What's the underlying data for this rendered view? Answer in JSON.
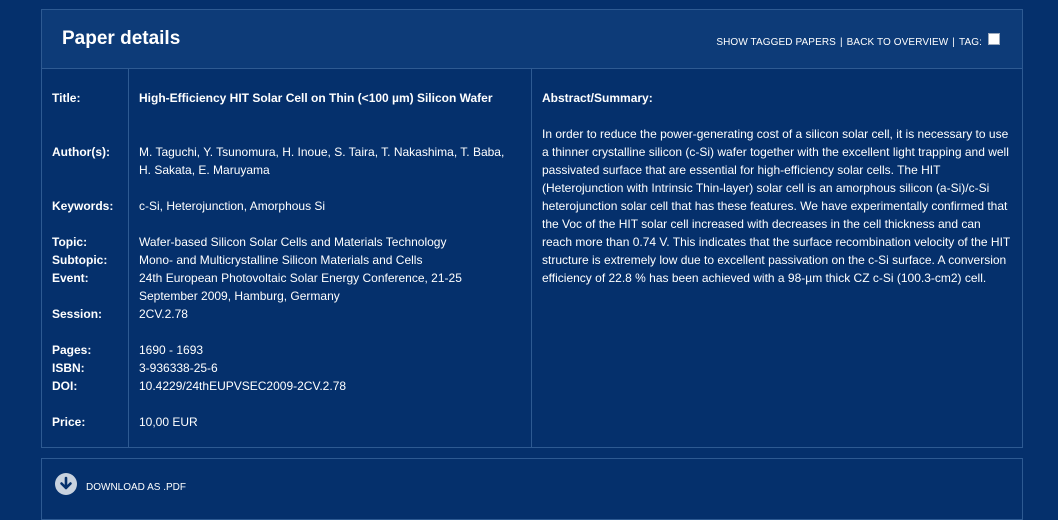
{
  "header": {
    "title": "Paper details",
    "show_tagged": "SHOW TAGGED PAPERS",
    "separator": "|",
    "back_to_overview": "BACK TO OVERVIEW",
    "tag_label": "TAG:"
  },
  "details": {
    "title_label": "Title:",
    "title_value": "High-Efficiency HIT Solar Cell on Thin (<100 µm) Silicon Wafer",
    "authors_label": "Author(s):",
    "authors_value": "M. Taguchi, Y. Tsunomura, H. Inoue, S. Taira, T. Nakashima, T. Baba, H. Sakata, E. Maruyama",
    "keywords_label": "Keywords:",
    "keywords_value": "c-Si, Heterojunction, Amorphous Si",
    "topic_label": "Topic:",
    "topic_value": "Wafer-based Silicon Solar Cells and Materials Technology",
    "subtopic_label": "Subtopic:",
    "subtopic_value": "Mono- and Multicrystalline Silicon Materials and Cells",
    "event_label": "Event:",
    "event_value": "24th European Photovoltaic Solar Energy Conference, 21-25 September 2009, Hamburg, Germany",
    "session_label": "Session:",
    "session_value": "2CV.2.78",
    "pages_label": "Pages:",
    "pages_value": "1690 - 1693",
    "isbn_label": "ISBN:",
    "isbn_value": "3-936338-25-6",
    "doi_label": "DOI:",
    "doi_value": "10.4229/24thEUPVSEC2009-2CV.2.78",
    "price_label": "Price:",
    "price_value": "10,00 EUR"
  },
  "abstract": {
    "heading": "Abstract/Summary:",
    "text": "In order to reduce the power-generating cost of a silicon solar cell, it is necessary to use a thinner crystalline silicon (c-Si) wafer together with the excellent light trapping and well passivated surface that are essential for high-efficiency solar cells. The HIT (Heterojunction with Intrinsic Thin-layer) solar cell is an amorphous silicon (a-Si)/c-Si heterojunction solar cell that has these features. We have experimentally confirmed that the Voc of the HIT solar cell increased with decreases in the cell thickness and can reach more than 0.74 V. This indicates that the surface recombination velocity of the HIT structure is extremely low due to excellent passivation on the c-Si surface. A conversion efficiency of 22.8 % has been achieved with a 98-µm thick CZ c-Si (100.3-cm2) cell."
  },
  "download": {
    "label": "DOWNLOAD AS .PDF",
    "icon": "download-arrow-icon"
  },
  "colors": {
    "background": "#05306c",
    "header_background": "#0d3b78",
    "border": "#2e5a92",
    "text": "#ffffff"
  }
}
